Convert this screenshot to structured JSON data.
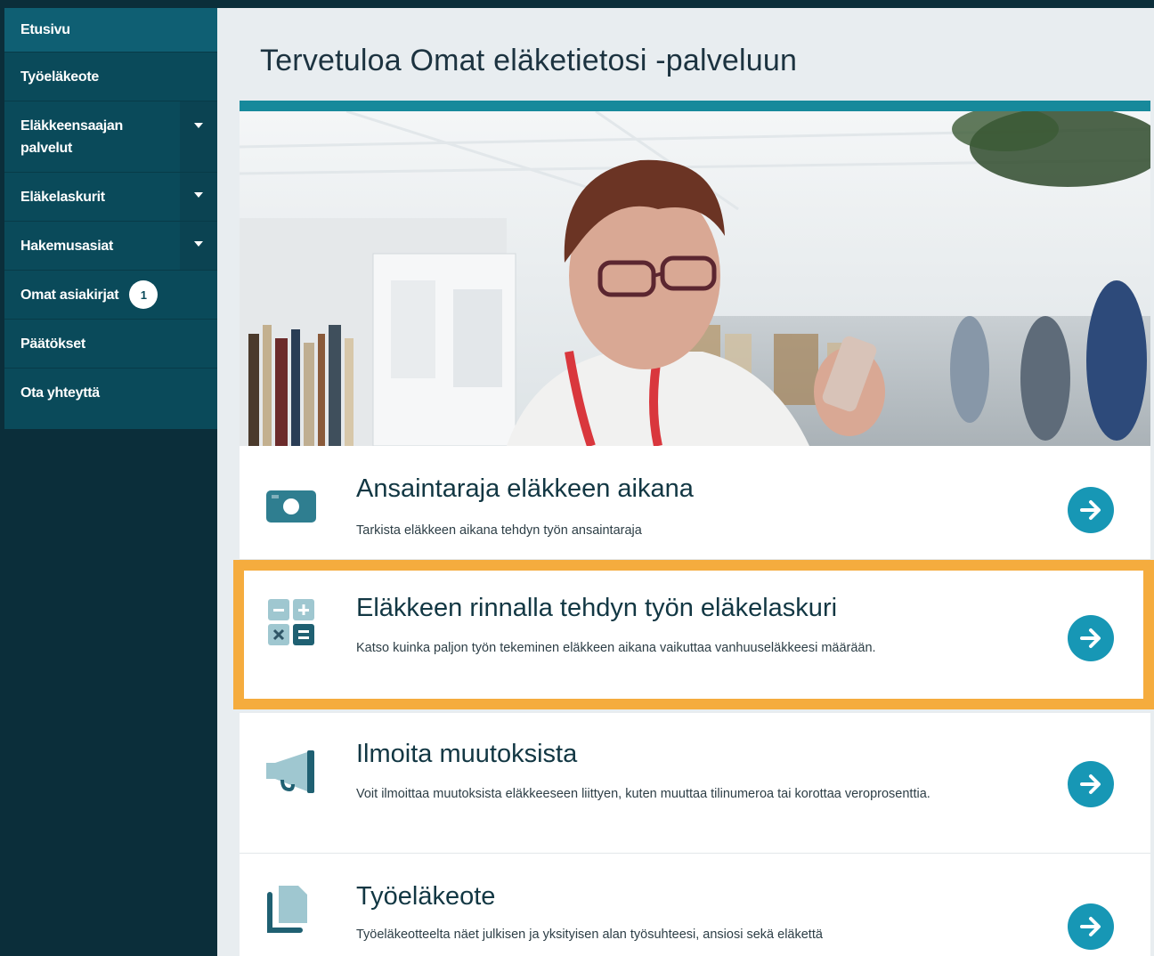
{
  "sidebar": {
    "items": [
      {
        "label": "Etusivu",
        "active": true
      },
      {
        "label": "Työeläkeote"
      },
      {
        "label_line1": "Eläkkeensaajan",
        "label_line2": "palvelut",
        "expandable": true
      },
      {
        "label": "Eläkelaskurit",
        "expandable": true
      },
      {
        "label": "Hakemusasiat",
        "expandable": true
      },
      {
        "label": "Omat asiakirjat",
        "badge": "1"
      },
      {
        "label": "Päätökset"
      },
      {
        "label": "Ota yhteyttä"
      }
    ]
  },
  "page": {
    "title": "Tervetuloa Omat eläketietosi -palveluun"
  },
  "cards": [
    {
      "title": "Ansaintaraja eläkkeen aikana",
      "desc": "Tarkista eläkkeen aikana tehdyn työn ansaintaraja",
      "icon": "money-icon"
    },
    {
      "title": "Eläkkeen rinnalla tehdyn työn eläkelaskuri",
      "desc": "Katso kuinka paljon työn tekeminen eläkkeen aikana vaikuttaa vanhuuseläkkeesi määrään.",
      "icon": "calculator-icon"
    },
    {
      "title": "Ilmoita muutoksista",
      "desc": "Voit ilmoittaa muutoksista eläkkeeseen liittyen, kuten muuttaa tilinumeroa tai korottaa veroprosenttia.",
      "icon": "megaphone-icon"
    },
    {
      "title": "Työeläkeote",
      "desc": "Työeläkeotteelta näet julkisen ja yksityisen alan työsuhteesi, ansiosi sekä eläkettä",
      "icon": "documents-icon"
    }
  ],
  "colors": {
    "sidebar_bg": "#0a4a5a",
    "accent": "#17899b",
    "arrow": "#1797b5",
    "highlight": "#f5ac3e"
  }
}
